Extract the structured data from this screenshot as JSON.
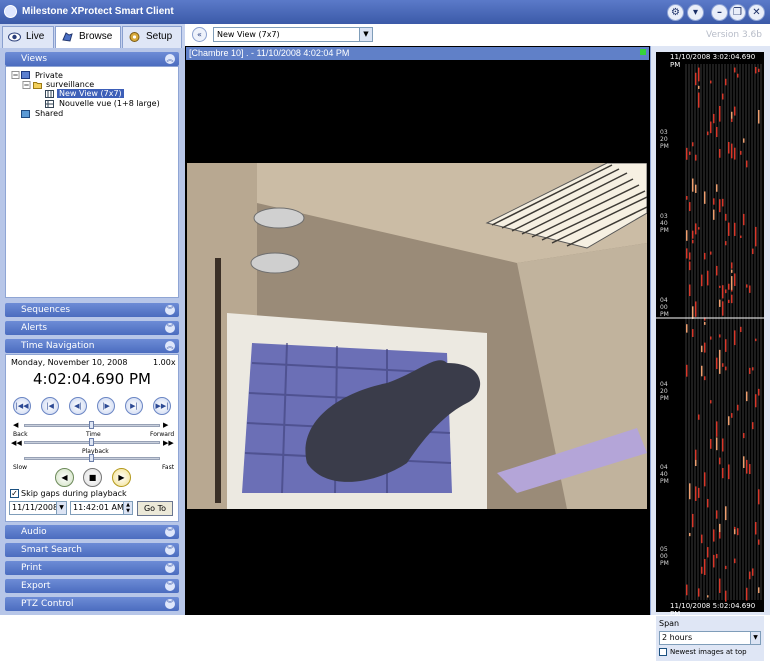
{
  "window": {
    "title": "Milestone XProtect Smart Client",
    "version": "Version 3.6b"
  },
  "tabs": [
    {
      "label": "Live",
      "icon": "eye-icon"
    },
    {
      "label": "Browse",
      "icon": "hand-icon"
    },
    {
      "label": "Setup",
      "icon": "gear-icon"
    }
  ],
  "view_selector": {
    "value": "New View (7x7)"
  },
  "views_panel": {
    "title": "Views",
    "tree": [
      {
        "label": "Private"
      },
      {
        "label": "surveillance"
      },
      {
        "label": "New View (7x7)"
      },
      {
        "label": "Nouvelle vue (1+8 large)"
      },
      {
        "label": "Shared"
      }
    ]
  },
  "panels": {
    "sequences": "Sequences",
    "alerts": "Alerts",
    "time_navigation": "Time Navigation",
    "audio": "Audio",
    "smart_search": "Smart Search",
    "print": "Print",
    "export": "Export",
    "ptz": "PTZ Control"
  },
  "time_navigation": {
    "date": "Monday, November 10, 2008",
    "speed": "1.00x",
    "time": "4:02:04.690 PM",
    "back_label": "Back",
    "time_label": "Time",
    "forward_label": "Forward",
    "playback_label": "Playback",
    "slow_label": "Slow",
    "fast_label": "Fast",
    "skip_gaps_label": "Skip gaps during playback",
    "skip_gaps_checked": true,
    "goto_date": "11/11/2008",
    "goto_time": "11:42:01 AM",
    "goto_label": "Go To"
  },
  "camera": {
    "title": "[Chambre 10] . - 11/10/2008 4:02:04 PM"
  },
  "timeline": {
    "top_time": "11/10/2008 3:02:04.690 PM",
    "bottom_time": "11/10/2008 5:02:04.690 PM",
    "labels": [
      {
        "lines": [
          "03",
          "20",
          "PM"
        ]
      },
      {
        "lines": [
          "03",
          "40",
          "PM"
        ]
      },
      {
        "lines": [
          "04",
          "00",
          "PM"
        ]
      },
      {
        "lines": [
          "04",
          "20",
          "PM"
        ]
      },
      {
        "lines": [
          "04",
          "40",
          "PM"
        ]
      },
      {
        "lines": [
          "05",
          "00",
          "PM"
        ]
      }
    ],
    "span_label": "Span",
    "span_value": "2 hours",
    "newest_top_label": "Newest images at top",
    "newest_top_checked": false
  }
}
